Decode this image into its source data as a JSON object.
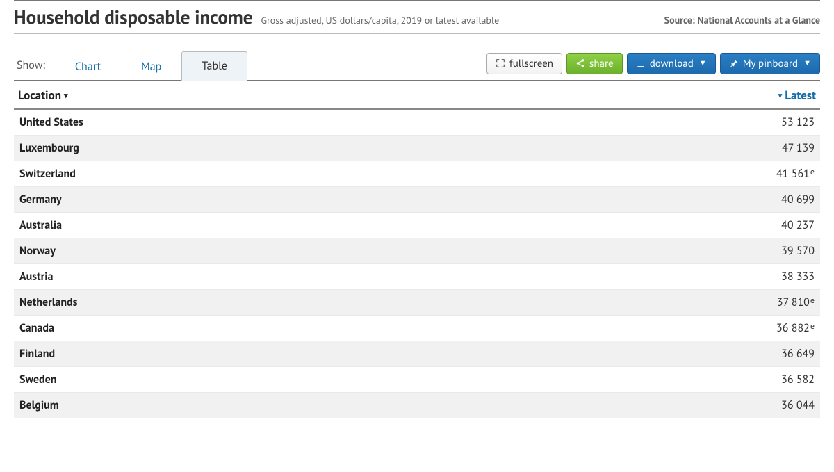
{
  "header": {
    "title": "Household disposable income",
    "subtitle": "Gross adjusted, US dollars/capita, 2019 or latest available",
    "source_prefix": "Source: ",
    "source_name": "National Accounts at a Glance"
  },
  "toolbar": {
    "show_label": "Show:",
    "tabs": {
      "chart": "Chart",
      "map": "Map",
      "table": "Table"
    },
    "active_tab": "table",
    "fullscreen": "fullscreen",
    "share": "share",
    "download": "download",
    "pinboard": "My pinboard"
  },
  "table": {
    "columns": {
      "location": "Location",
      "latest": "Latest"
    },
    "sort": {
      "column": "latest",
      "direction": "desc"
    }
  },
  "chart_data": {
    "type": "table",
    "title": "Household disposable income",
    "subtitle": "Gross adjusted, US dollars/capita, 2019 or latest available",
    "columns": [
      "Location",
      "Latest"
    ],
    "units": "US dollars per capita",
    "rows": [
      {
        "location": "United States",
        "value": 53123,
        "note": ""
      },
      {
        "location": "Luxembourg",
        "value": 47139,
        "note": ""
      },
      {
        "location": "Switzerland",
        "value": 41561,
        "note": "e"
      },
      {
        "location": "Germany",
        "value": 40699,
        "note": ""
      },
      {
        "location": "Australia",
        "value": 40237,
        "note": ""
      },
      {
        "location": "Norway",
        "value": 39570,
        "note": ""
      },
      {
        "location": "Austria",
        "value": 38333,
        "note": ""
      },
      {
        "location": "Netherlands",
        "value": 37810,
        "note": "e"
      },
      {
        "location": "Canada",
        "value": 36882,
        "note": "e"
      },
      {
        "location": "Finland",
        "value": 36649,
        "note": ""
      },
      {
        "location": "Sweden",
        "value": 36582,
        "note": ""
      },
      {
        "location": "Belgium",
        "value": 36044,
        "note": ""
      }
    ]
  }
}
